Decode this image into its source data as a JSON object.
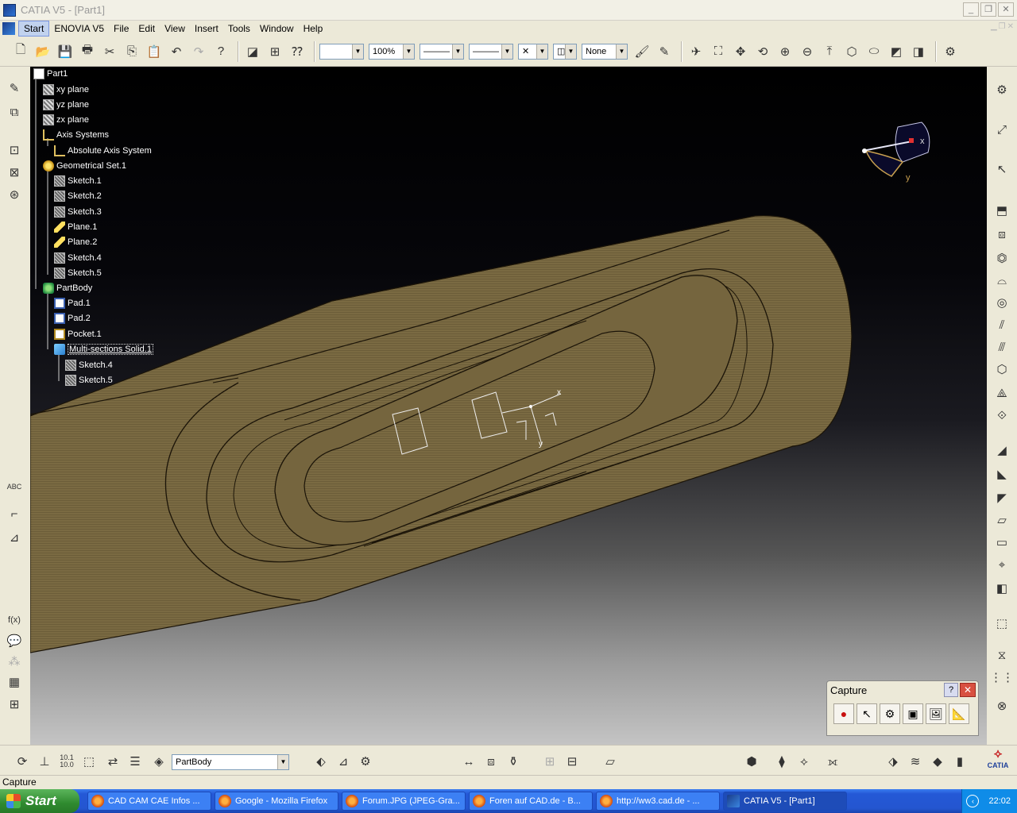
{
  "window": {
    "title": "CATIA V5 - [Part1]"
  },
  "menu": [
    {
      "label": "Start",
      "active": true
    },
    {
      "label": "ENOVIA V5"
    },
    {
      "label": "File"
    },
    {
      "label": "Edit"
    },
    {
      "label": "View"
    },
    {
      "label": "Insert"
    },
    {
      "label": "Tools"
    },
    {
      "label": "Window"
    },
    {
      "label": "Help"
    }
  ],
  "toolbar": {
    "zoom_value": "100%",
    "layer_value": "None",
    "combo_line_color": "",
    "point_style": "✕"
  },
  "tree": {
    "root": "Part1",
    "xy_plane": "xy plane",
    "yz_plane": "yz plane",
    "zx_plane": "zx plane",
    "axis_systems": "Axis Systems",
    "absolute_axis": "Absolute Axis System",
    "geo_set": "Geometrical Set.1",
    "sketch1": "Sketch.1",
    "sketch2": "Sketch.2",
    "sketch3": "Sketch.3",
    "plane1": "Plane.1",
    "plane2": "Plane.2",
    "sketch4": "Sketch.4",
    "sketch5": "Sketch.5",
    "partbody": "PartBody",
    "pad1": "Pad.1",
    "pad2": "Pad.2",
    "pocket1": "Pocket.1",
    "msolid": "Multi-sections Solid.1",
    "msolid_sketch4": "Sketch.4",
    "msolid_sketch5": "Sketch.5"
  },
  "compass": {
    "x": "x",
    "y": "y"
  },
  "capture": {
    "title": "Capture",
    "help": "?",
    "close": "✕"
  },
  "bottom": {
    "scale_label_top": "10.1",
    "scale_label_bottom": "10.0",
    "body_select": "PartBody",
    "catia_logo": "CATIA"
  },
  "left_toolbar": {
    "abc_label": "ABC",
    "formula_label": "f(x)"
  },
  "status": {
    "text": "Capture"
  },
  "taskbar": {
    "start": "Start",
    "tasks": [
      {
        "label": "CAD CAM CAE Infos ..."
      },
      {
        "label": "Google - Mozilla Firefox"
      },
      {
        "label": "Forum.JPG (JPEG-Gra..."
      },
      {
        "label": "Foren auf CAD.de - B..."
      },
      {
        "label": "http://ww3.cad.de - ..."
      },
      {
        "label": "CATIA V5 - [Part1]",
        "active": true
      }
    ],
    "clock": "22:02"
  },
  "colors": {
    "part_fill": "#7a6a42",
    "edge": "#1b1408",
    "viewport_top": "#000000",
    "viewport_bottom": "#c4c4c4",
    "taskbar": "#2456d0"
  }
}
